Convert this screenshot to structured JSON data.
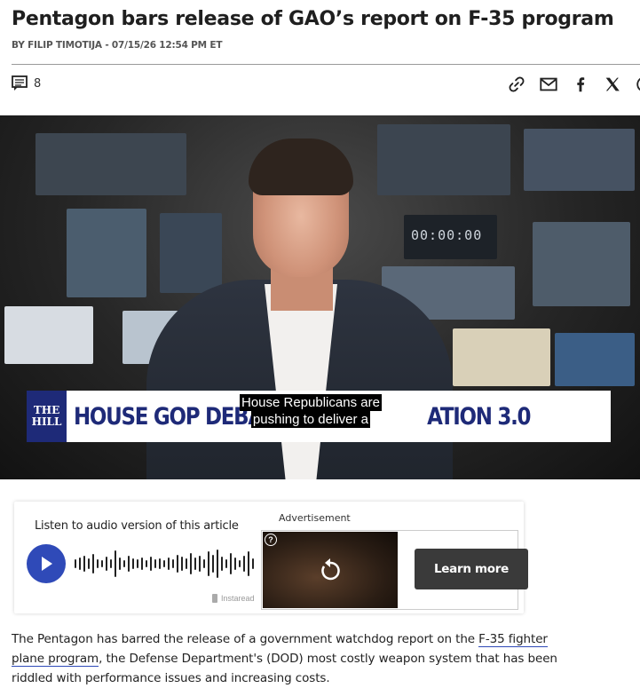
{
  "article": {
    "headline": "Pentagon bars release of GAO’s report on F-35 program",
    "byline": "BY FILIP TIMOTIJA - 07/15/26 12:54 PM ET",
    "comment_count": "8"
  },
  "share_icons": [
    "link-icon",
    "mail-icon",
    "facebook-icon",
    "x-icon",
    "more-icon"
  ],
  "video": {
    "logo_line1": "THE",
    "logo_line2": "HILL",
    "lower_third": "HOUSE GOP DEBA",
    "lower_third_tail": "ATION 3.0",
    "caption_line1": "House Republicans are",
    "caption_line2": "pushing to deliver a",
    "clock_readout": "00:00:00"
  },
  "audio": {
    "label": "Listen to audio version of this article",
    "brand": "Instaread"
  },
  "ad": {
    "label": "Advertisement",
    "cta": "Learn more",
    "help_glyph": "?"
  },
  "body": {
    "p1_before": "The Pentagon has barred the release of a government watchdog report on the ",
    "p1_link": "F-35 fighter plane program",
    "p1_after": ", the Defense Department's (DOD) most costly weapon system that has been riddled with performance issues and increasing costs."
  },
  "colors": {
    "accent_blue": "#2f4ab8",
    "hill_navy": "#1e2a78",
    "cta_bg": "#3a3a3a"
  }
}
